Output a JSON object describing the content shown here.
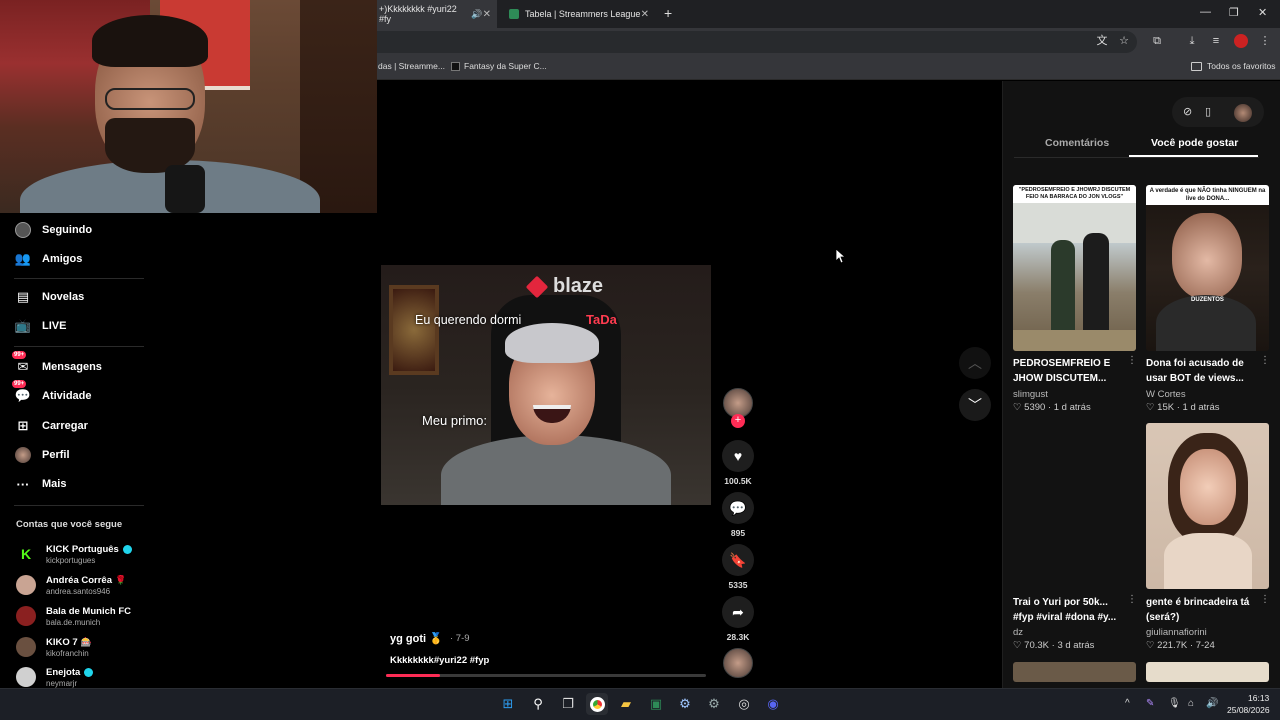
{
  "browser": {
    "tabs": [
      {
        "label": "+)Kkkkkkkk #yuri22 #fy",
        "active": true
      },
      {
        "label": "Tabela | Streammers League",
        "active": false
      }
    ],
    "new_tab_label": "+",
    "bookmarks": [
      {
        "label": "das | Streamme..."
      },
      {
        "label": "Fantasy da Super C..."
      }
    ],
    "all_bookmarks_label": "Todos os favoritos"
  },
  "nav": {
    "items": [
      {
        "label": "Seguindo",
        "icon": "following-icon"
      },
      {
        "label": "Amigos",
        "icon": "friends-icon"
      },
      {
        "label": "Novelas",
        "icon": "novelas-icon"
      },
      {
        "label": "LIVE",
        "icon": "live-icon"
      },
      {
        "label": "Mensagens",
        "icon": "messages-icon",
        "badge": "99+"
      },
      {
        "label": "Atividade",
        "icon": "activity-icon",
        "badge": "99+"
      },
      {
        "label": "Carregar",
        "icon": "upload-icon"
      },
      {
        "label": "Perfil",
        "icon": "profile-icon"
      },
      {
        "label": "Mais",
        "icon": "more-icon"
      }
    ],
    "following_title": "Contas que você segue",
    "accounts": [
      {
        "name": "KICK Português",
        "handle": "kickportugues",
        "verified": true,
        "color": "#53fc18"
      },
      {
        "name": "Andréa Corrêa",
        "handle": "andrea.santos946",
        "verified": false,
        "color": "#c9a493"
      },
      {
        "name": "Bala de Munich FC",
        "handle": "bala.de.munich",
        "verified": false,
        "color": "#8a2020"
      },
      {
        "name": "KIKO 7",
        "handle": "kikofranchin",
        "verified": false,
        "color": "#6a5040"
      },
      {
        "name": "Enejota",
        "handle": "neymarjr",
        "verified": true,
        "color": "#d0d0d0"
      }
    ]
  },
  "video": {
    "overlay_logo": "blaze",
    "overlay_tag": "TaDa",
    "caption_top": "Eu querendo dormi",
    "caption_mid": "Meu primo:",
    "author": "yg goti 🥇",
    "date": "· 7-9",
    "description": "Kkkkkkkk#yuri22 #fyp",
    "progress": 0.17
  },
  "actions": {
    "likes": "100.5K",
    "comments": "895",
    "saves": "5335",
    "shares": "28.3K"
  },
  "right": {
    "tab_comments": "Comentários",
    "tab_like": "Você pode gostar",
    "cards": [
      {
        "title": "PEDROSEMFREIO E JHOW DISCUTEM...",
        "user": "slimgust",
        "likes": "5390",
        "age": "1 d atrás",
        "thumb_text": "\"PEDROSEMFREIO E JHOWRJ DISCUTEM FEIO NA BARRACA DO JON VLOGS\""
      },
      {
        "title": "Dona foi acusado de usar BOT de views...",
        "user": "W Cortes",
        "likes": "15K",
        "age": "1 d atrás",
        "thumb_text": "A verdade é que NÃO tinha NINGUEM na live do DONA...",
        "thumb_label": "DUZENTOS"
      },
      {
        "title": "Trai o Yuri por 50k... #fyp #viral #dona #y...",
        "user": "dz",
        "likes": "70.3K",
        "age": "3 d atrás"
      },
      {
        "title": "gente é brincadeira tá (será?)",
        "user": "giuliannafiorini",
        "likes": "221.7K",
        "age": "7-24"
      }
    ]
  },
  "taskbar": {
    "time": "16:13",
    "date": "25/08/2026"
  }
}
